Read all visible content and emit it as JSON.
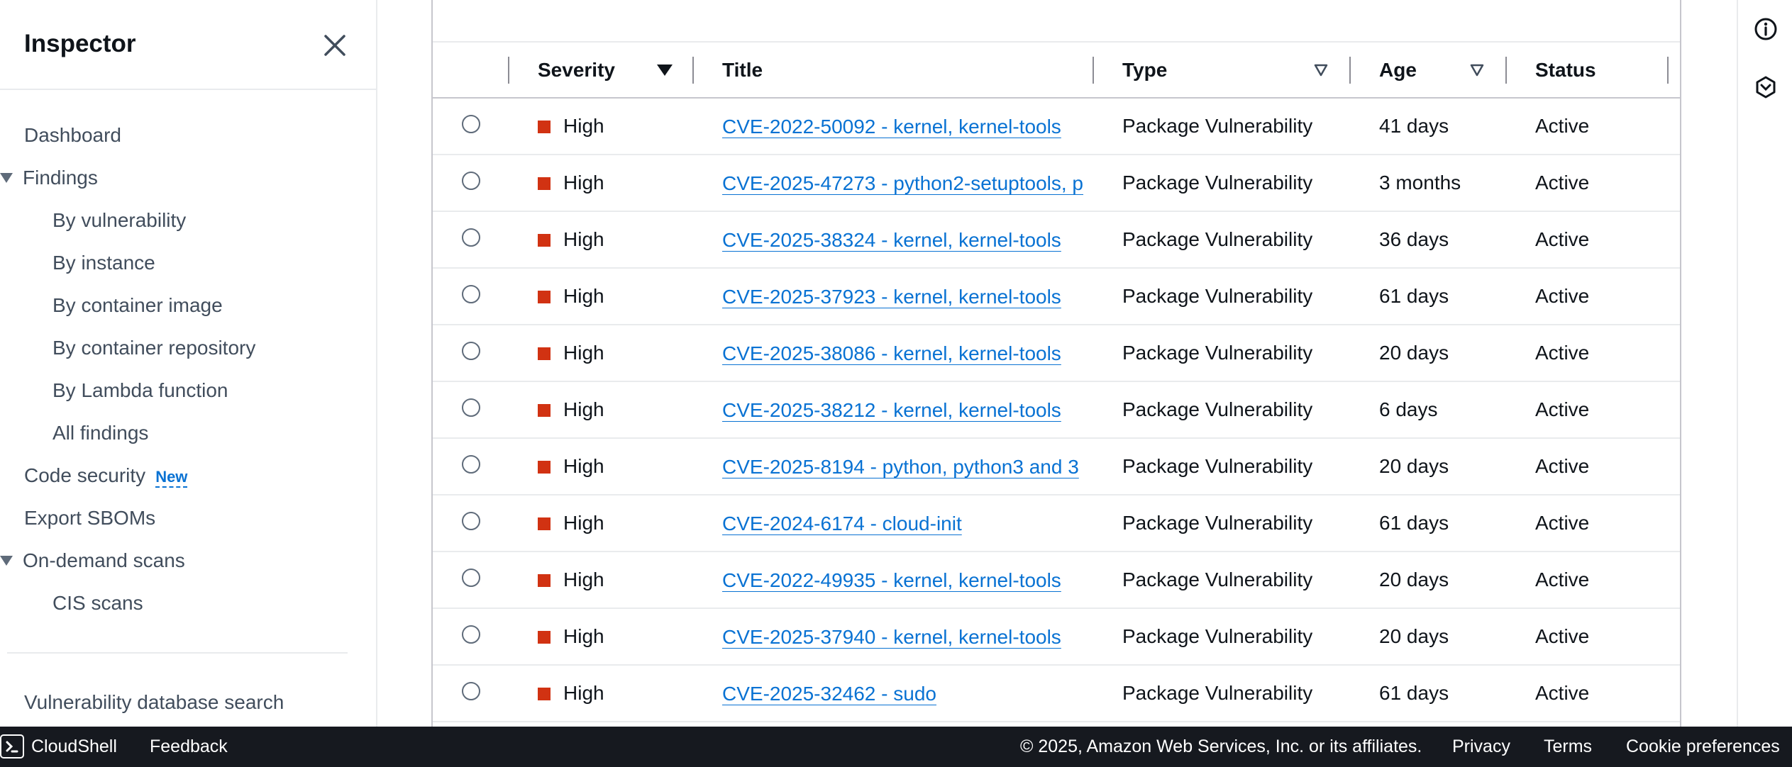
{
  "sidebar": {
    "title": "Inspector",
    "items": [
      {
        "label": "Dashboard"
      },
      {
        "label": "Findings"
      },
      {
        "label": "By vulnerability"
      },
      {
        "label": "By instance"
      },
      {
        "label": "By container image"
      },
      {
        "label": "By container repository"
      },
      {
        "label": "By Lambda function"
      },
      {
        "label": "All findings"
      },
      {
        "label": "Code security",
        "badge": "New"
      },
      {
        "label": "Export SBOMs"
      },
      {
        "label": "On-demand scans"
      },
      {
        "label": "CIS scans"
      },
      {
        "label": "Vulnerability database search"
      }
    ]
  },
  "table": {
    "columns": {
      "severity": "Severity",
      "title": "Title",
      "type": "Type",
      "age": "Age",
      "status": "Status"
    },
    "rows": [
      {
        "severity": "High",
        "title": "CVE-2022-50092 - kernel, kernel-tools",
        "type": "Package Vulnerability",
        "age": "41 days",
        "status": "Active"
      },
      {
        "severity": "High",
        "title": "CVE-2025-47273 - python2-setuptools, p",
        "type": "Package Vulnerability",
        "age": "3 months",
        "status": "Active"
      },
      {
        "severity": "High",
        "title": "CVE-2025-38324 - kernel, kernel-tools",
        "type": "Package Vulnerability",
        "age": "36 days",
        "status": "Active"
      },
      {
        "severity": "High",
        "title": "CVE-2025-37923 - kernel, kernel-tools",
        "type": "Package Vulnerability",
        "age": "61 days",
        "status": "Active"
      },
      {
        "severity": "High",
        "title": "CVE-2025-38086 - kernel, kernel-tools",
        "type": "Package Vulnerability",
        "age": "20 days",
        "status": "Active"
      },
      {
        "severity": "High",
        "title": "CVE-2025-38212 - kernel, kernel-tools",
        "type": "Package Vulnerability",
        "age": "6 days",
        "status": "Active"
      },
      {
        "severity": "High",
        "title": "CVE-2025-8194 - python, python3 and 3",
        "type": "Package Vulnerability",
        "age": "20 days",
        "status": "Active"
      },
      {
        "severity": "High",
        "title": "CVE-2024-6174 - cloud-init",
        "type": "Package Vulnerability",
        "age": "61 days",
        "status": "Active"
      },
      {
        "severity": "High",
        "title": "CVE-2022-49935 - kernel, kernel-tools",
        "type": "Package Vulnerability",
        "age": "20 days",
        "status": "Active"
      },
      {
        "severity": "High",
        "title": "CVE-2025-37940 - kernel, kernel-tools",
        "type": "Package Vulnerability",
        "age": "20 days",
        "status": "Active"
      },
      {
        "severity": "High",
        "title": "CVE-2025-32462 - sudo",
        "type": "Package Vulnerability",
        "age": "61 days",
        "status": "Active"
      }
    ]
  },
  "footer": {
    "cloudshell": "CloudShell",
    "feedback": "Feedback",
    "copyright": "© 2025, Amazon Web Services, Inc. or its affiliates.",
    "privacy": "Privacy",
    "terms": "Terms",
    "cookies": "Cookie preferences"
  },
  "colors": {
    "severity_high": "#d13212",
    "link": "#0972d3",
    "footer_bg": "#16191f"
  },
  "icons": {
    "close": "close-icon",
    "info": "info-icon",
    "hex": "hexagon-icon",
    "cloudshell": "cloudshell-icon"
  }
}
